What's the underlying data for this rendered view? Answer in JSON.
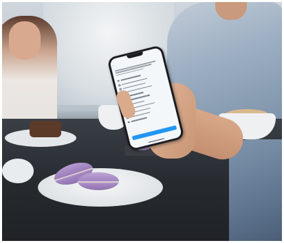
{
  "scene": {
    "phone_screen": {
      "rows": 11,
      "accent_color": "#2196f3"
    },
    "colors": {
      "macaron": "#a98dc6",
      "table": "#262a2f",
      "shirt": "#8095ac"
    }
  }
}
